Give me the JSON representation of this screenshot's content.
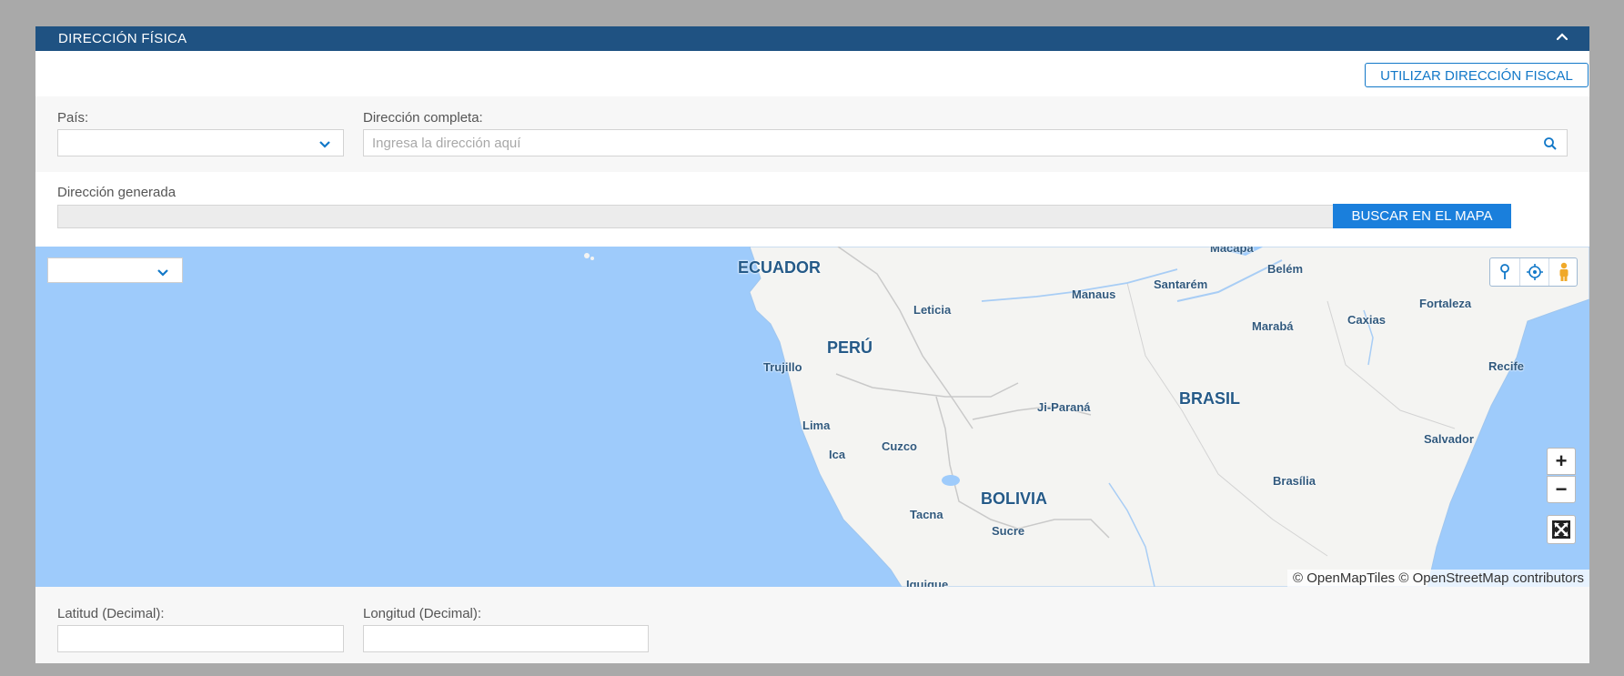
{
  "panel": {
    "title": "DIRECCIÓN FÍSICA",
    "fiscal_button": "UTILIZAR DIRECCIÓN FISCAL"
  },
  "form": {
    "country_label": "País:",
    "country_value": "",
    "address_label": "Dirección completa:",
    "address_placeholder": "Ingresa la dirección aquí",
    "address_value": "",
    "generated_label": "Dirección generada",
    "generated_value": "",
    "map_search_button": "BUSCAR EN EL MAPA",
    "latitude_label": "Latitud (Decimal):",
    "latitude_value": "",
    "longitude_label": "Longitud (Decimal):",
    "longitude_value": ""
  },
  "map": {
    "layer_value": "",
    "labels": {
      "ecuador": "ECUADOR",
      "peru": "PERÚ",
      "brasil": "BRASIL",
      "bolivia": "BOLIVIA",
      "macapa": "Macapá",
      "belem": "Belém",
      "santarem": "Santarém",
      "manaus": "Manaus",
      "leticia": "Leticia",
      "fortaleza": "Fortaleza",
      "caxias": "Caxias",
      "maraba": "Marabá",
      "trujillo": "Trujillo",
      "recife": "Recife",
      "ji_parana": "Ji-Paraná",
      "lima": "Lima",
      "cuzco": "Cuzco",
      "ica": "Ica",
      "salvador": "Salvador",
      "brasilia": "Brasília",
      "tacna": "Tacna",
      "sucre": "Sucre",
      "iquique": "Iquique"
    },
    "zoom_in": "+",
    "zoom_out": "−",
    "attribution": "© OpenMapTiles © OpenStreetMap contributors",
    "icons": [
      "pin-icon",
      "locate-icon",
      "street-view-icon",
      "fullscreen-icon",
      "chevron-up-icon",
      "chevron-down-icon",
      "search-icon"
    ]
  },
  "colors": {
    "header": "#1f5282",
    "accent": "#1278c8",
    "map_water": "#9ecbfb",
    "map_land": "#f4f4f2"
  }
}
